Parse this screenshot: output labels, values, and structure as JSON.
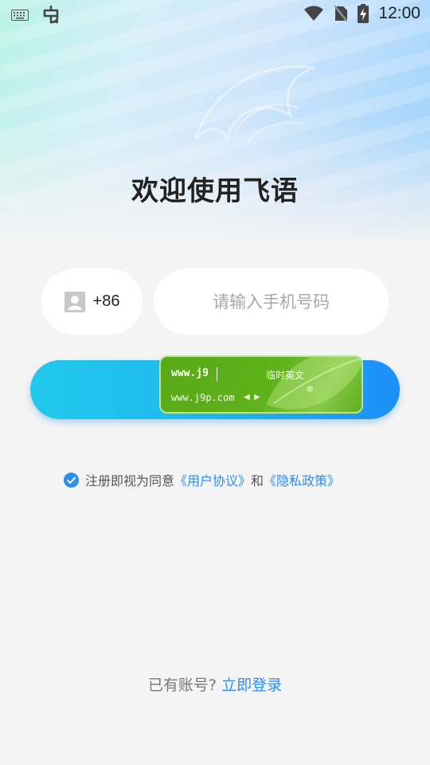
{
  "status_bar": {
    "time": "12:00",
    "icons": [
      "keyboard-icon",
      "bug-icon",
      "wifi-icon",
      "no-sim-icon",
      "battery-charging-icon"
    ]
  },
  "welcome": {
    "title": "欢迎使用飞语"
  },
  "form": {
    "country_code": "+86",
    "phone_placeholder": "请输入手机号码",
    "phone_value": ""
  },
  "ime": {
    "composing": "www.j9",
    "mode_label": "临时英文",
    "candidate": "www.j9p.com",
    "arrow_left": "◀",
    "arrow_right": "▶"
  },
  "agreement": {
    "prefix": "注册即视为同意",
    "user_agreement": "《用户协议》",
    "conjunction": "和",
    "privacy_policy": "《隐私政策》",
    "checked": true
  },
  "login": {
    "prompt": "已有账号?",
    "link": "立即登录"
  },
  "colors": {
    "accent": "#2a8ff0",
    "button_start": "#22c9ec",
    "button_end": "#1d8ef7",
    "ime_green": "#5fb21b"
  }
}
